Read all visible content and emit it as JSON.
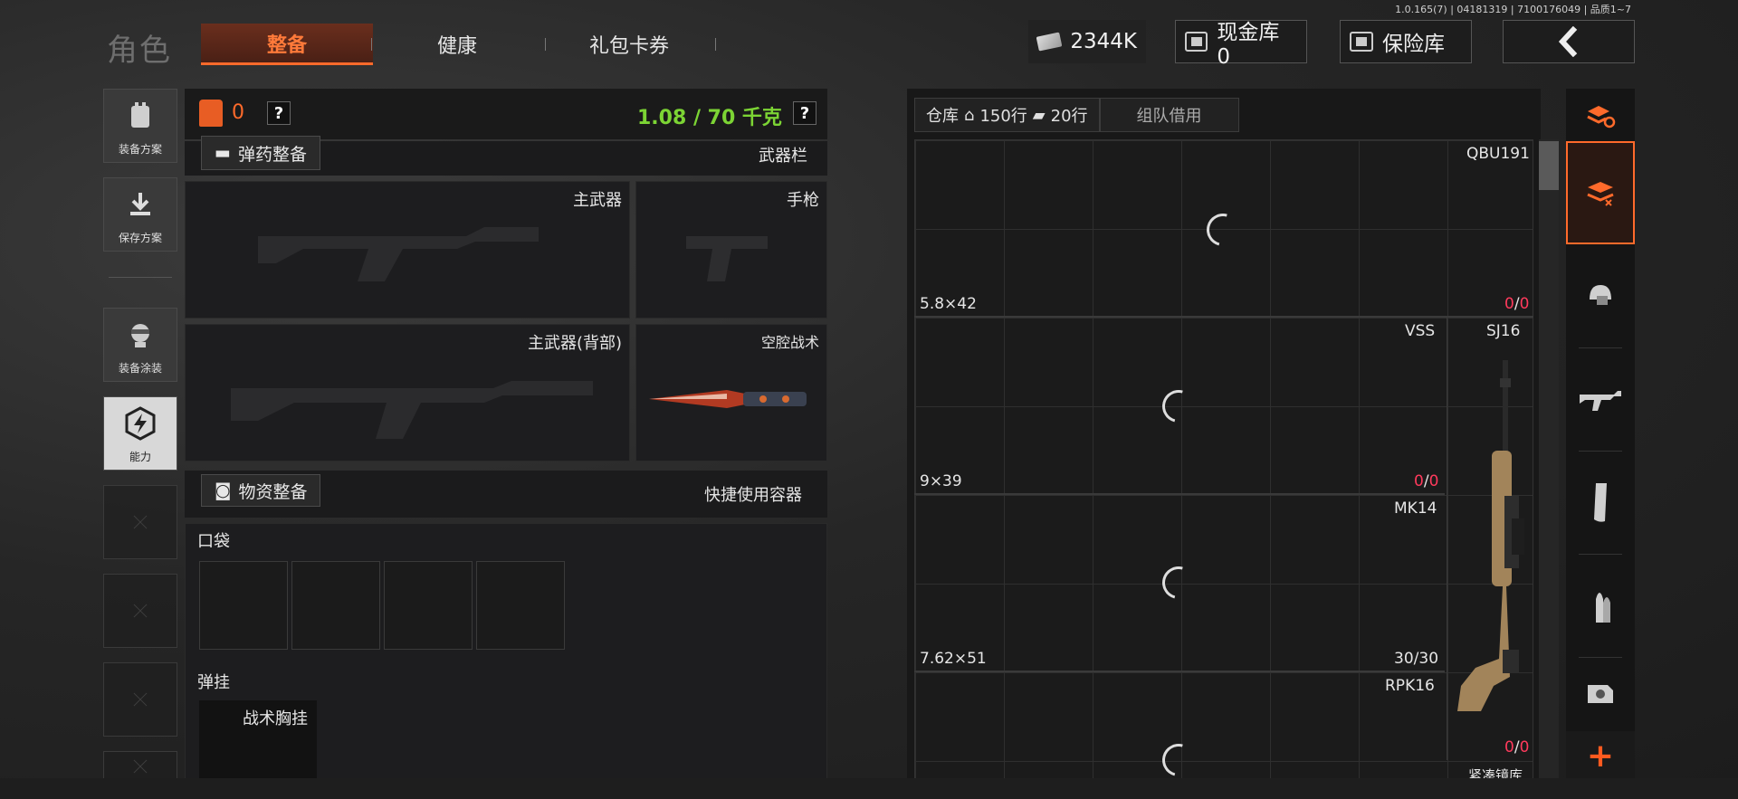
{
  "version": "1.0.165(7) | 04181319 | 7100176049 | 品质1~7",
  "header": {
    "title": "角色",
    "tabs": [
      "整备",
      "健康",
      "礼包卡券"
    ],
    "money": "2344K",
    "cash_vault": "现金库 0",
    "safe": "保险库"
  },
  "sidebar": {
    "items": [
      {
        "label": "装备方案",
        "icon": "vest-icon"
      },
      {
        "label": "保存方案",
        "icon": "download-icon"
      },
      {
        "label": "装备涂装",
        "icon": "helmet-head-icon"
      },
      {
        "label": "能力",
        "icon": "lightning-hex-icon"
      }
    ]
  },
  "equipment": {
    "count": "0",
    "weight": "1.08 / 70 千克",
    "help": "?",
    "ammo_button": "弹药整备",
    "weapon_bar": "武器栏",
    "slots": {
      "primary": "主武器",
      "pistol": "手枪",
      "primary_back": "主武器(背部)",
      "melee": "空腔战术"
    },
    "supply_button": "物资整备",
    "quick_container": "快捷使用容器",
    "pocket": "口袋",
    "rig": "弹挂",
    "rig_item": "战术胸挂"
  },
  "warehouse": {
    "tab_label": "仓库",
    "rows_home": "150行",
    "rows_cash": "20行",
    "team_borrow": "组队借用",
    "rows": [
      {
        "guns": [
          "QBU191"
        ],
        "caliber": "5.8×42",
        "ammo_have": "0",
        "ammo_total": "0"
      },
      {
        "guns": [
          "VSS"
        ],
        "caliber": "9×39",
        "ammo_have": "0",
        "ammo_total": "0"
      },
      {
        "guns": [
          "MK14"
        ],
        "caliber": "7.62×51",
        "ammo_have": "30",
        "ammo_total": "30"
      },
      {
        "guns": [
          "RPK16"
        ],
        "caliber": "",
        "ammo_have": "0",
        "ammo_total": "0"
      }
    ],
    "featured_gun": "SJ16",
    "scope_label": "紧凑镜库"
  },
  "rail": {
    "icons": [
      "stack-refresh-icon",
      "stack-down-icon",
      "helmet-icon",
      "rifle-icon",
      "magazine-icon",
      "bullet-icon",
      "scope-icon"
    ],
    "plus": "+"
  },
  "colors": {
    "accent": "#ff6a2b",
    "weight_green": "#7cd434",
    "ammo_red": "#ff3a5c"
  }
}
